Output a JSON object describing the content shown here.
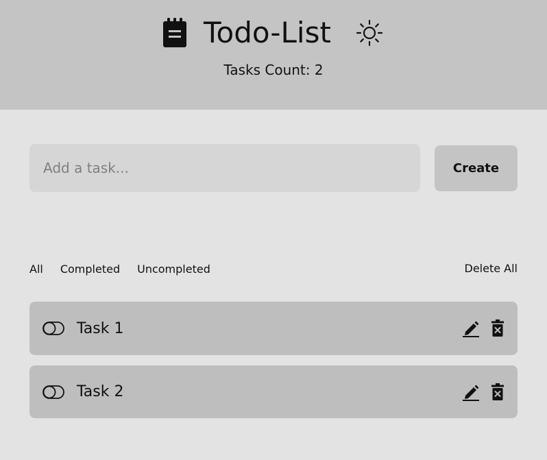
{
  "header": {
    "title": "Todo-List",
    "tasks_count_label": "Tasks Count: 2",
    "app_icon": "notepad-icon",
    "theme_icon": "sun-icon"
  },
  "create": {
    "placeholder": "Add a task...",
    "button_label": "Create"
  },
  "filters": {
    "items": [
      {
        "label": "All"
      },
      {
        "label": "Completed"
      },
      {
        "label": "Uncompleted"
      }
    ],
    "delete_all_label": "Delete All"
  },
  "tasks": [
    {
      "label": "Task 1",
      "completed": false
    },
    {
      "label": "Task 2",
      "completed": false
    }
  ],
  "colors": {
    "header_bg": "#c4c4c4",
    "page_bg": "#e3e3e3",
    "input_bg": "#d6d6d6",
    "task_bg": "#bebebe",
    "text": "#111111"
  }
}
